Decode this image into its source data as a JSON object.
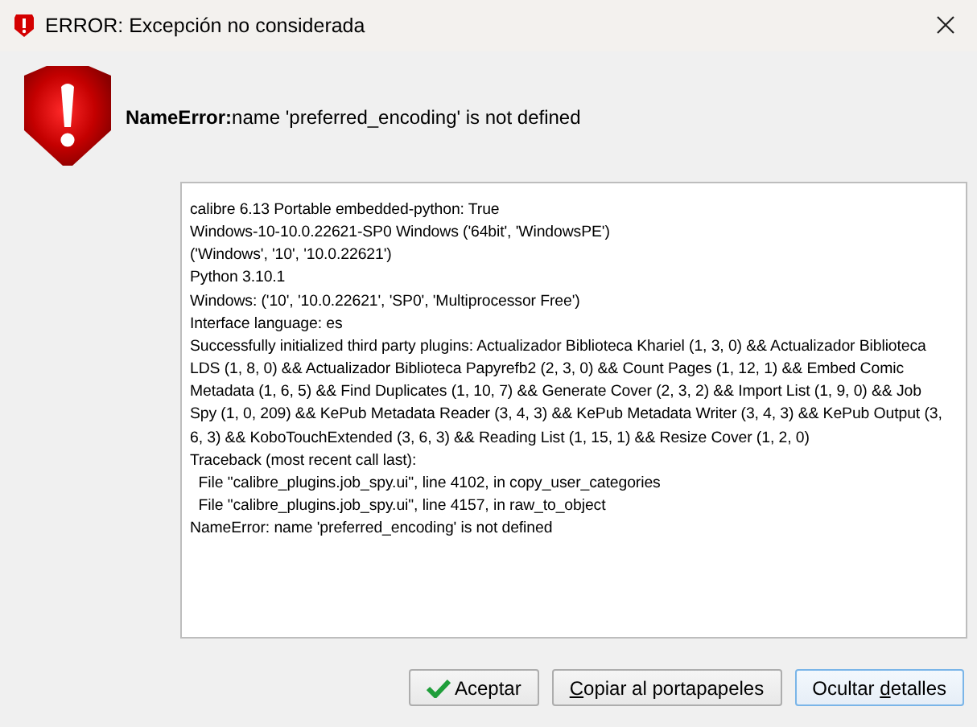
{
  "window": {
    "title": "ERROR: Excepción no considerada"
  },
  "message": {
    "error_name": "NameError:",
    "text": "name 'preferred_encoding' is not defined"
  },
  "details": {
    "lines": [
      "calibre 6.13 Portable embedded-python: True",
      "Windows-10-10.0.22621-SP0 Windows ('64bit', 'WindowsPE')",
      "('Windows', '10', '10.0.22621')",
      "Python 3.10.1",
      "Windows: ('10', '10.0.22621', 'SP0', 'Multiprocessor Free')",
      "Interface language: es",
      "Successfully initialized third party plugins: Actualizador Biblioteca Khariel (1, 3, 0) && Actualizador Biblioteca",
      "LDS (1, 8, 0) && Actualizador Biblioteca Papyrefb2 (2, 3, 0) && Count Pages (1, 12, 1) && Embed Comic",
      "Metadata (1, 6, 5) && Find Duplicates (1, 10, 7) && Generate Cover (2, 3, 2) && Import List (1, 9, 0) && Job",
      "Spy (1, 0, 209) && KePub Metadata Reader (3, 4, 3) && KePub Metadata Writer (3, 4, 3) && KePub Output (3,",
      "6, 3) && KoboTouchExtended (3, 6, 3) && Reading List (1, 15, 1) && Resize Cover (1, 2, 0)",
      "Traceback (most recent call last):",
      "  File \"calibre_plugins.job_spy.ui\", line 4102, in copy_user_categories",
      "  File \"calibre_plugins.job_spy.ui\", line 4157, in raw_to_object",
      "NameError: name 'preferred_encoding' is not defined"
    ]
  },
  "buttons": [
    {
      "kind": "accept",
      "before": "Aceptar",
      "focused": false
    },
    {
      "kind": "plain",
      "key": "C",
      "after": "opiar al portapapeles",
      "focused": false
    },
    {
      "kind": "plain",
      "before": "Ocultar ",
      "key": "d",
      "after": "etalles",
      "focused": true
    }
  ]
}
